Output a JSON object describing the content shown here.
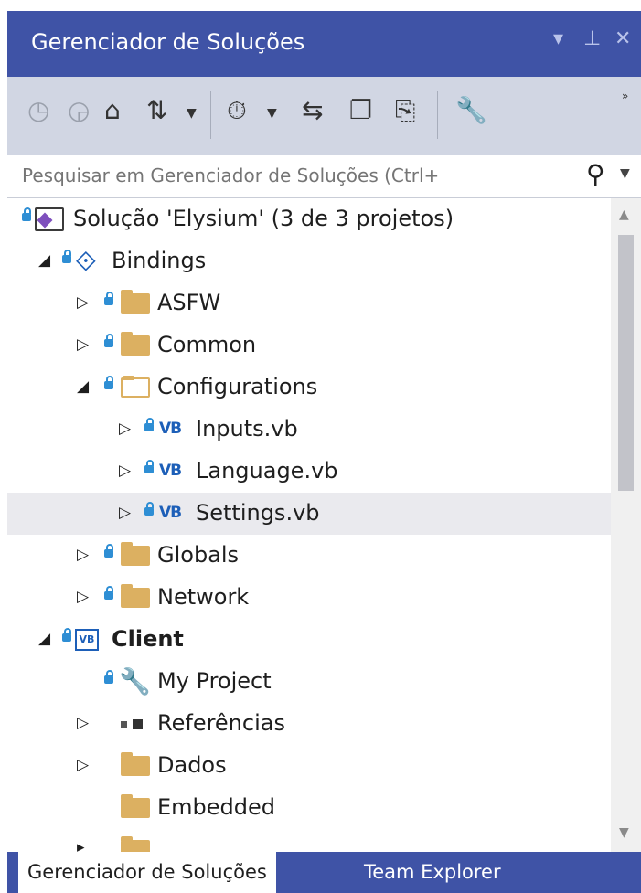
{
  "window": {
    "title": "Gerenciador de Soluções",
    "dropdown_icon": "chevron-down-icon",
    "pin_icon": "pin-icon",
    "close_icon": "close-icon"
  },
  "toolbar": {
    "buttons": [
      {
        "icon": "back-icon",
        "glyph": "◷"
      },
      {
        "icon": "forward-icon",
        "glyph": "◶"
      },
      {
        "icon": "home-icon",
        "glyph": "⌂"
      },
      {
        "icon": "switch-views-icon",
        "glyph": "⇅"
      },
      {
        "icon": "pending-changes-filter-icon",
        "glyph": "⏱"
      },
      {
        "icon": "sync-active-document-icon",
        "glyph": "⇆"
      },
      {
        "icon": "collapse-all-icon",
        "glyph": "❐"
      },
      {
        "icon": "show-all-files-icon",
        "glyph": "🗐"
      },
      {
        "icon": "properties-wrench-icon",
        "glyph": "🔧"
      }
    ]
  },
  "search": {
    "placeholder": "Pesquisar em Gerenciador de Soluções (Ctrl+"
  },
  "tree": [
    {
      "label": "Solução 'Elysium' (3 de 3 projetos)",
      "icon": "solution-icon"
    },
    {
      "label": "Bindings",
      "icon": "shared-project-icon",
      "expanded": true
    },
    {
      "label": "ASFW",
      "icon": "folder-icon",
      "expanded": false
    },
    {
      "label": "Common",
      "icon": "folder-icon",
      "expanded": false
    },
    {
      "label": "Configurations",
      "icon": "folder-open-icon",
      "expanded": true
    },
    {
      "label": "Inputs.vb",
      "icon": "vb-file-icon",
      "expanded": false
    },
    {
      "label": "Language.vb",
      "icon": "vb-file-icon",
      "expanded": false
    },
    {
      "label": "Settings.vb",
      "icon": "vb-file-icon",
      "expanded": false,
      "selected": true
    },
    {
      "label": "Globals",
      "icon": "folder-icon",
      "expanded": false
    },
    {
      "label": "Network",
      "icon": "folder-icon",
      "expanded": false
    },
    {
      "label": "Client",
      "icon": "vb-project-icon",
      "expanded": true,
      "bold": true
    },
    {
      "label": "My Project",
      "icon": "wrench-icon"
    },
    {
      "label": "Referências",
      "icon": "references-icon",
      "expanded": false
    },
    {
      "label": "Dados",
      "icon": "folder-icon",
      "expanded": false
    },
    {
      "label": "Embedded",
      "icon": "folder-icon"
    }
  ],
  "tabs": [
    {
      "label": "Gerenciador de Soluções",
      "active": true
    },
    {
      "label": "Team Explorer",
      "active": false
    }
  ],
  "colors": {
    "title_bar": "#3f53a6",
    "toolbar": "#d1d6e3",
    "selected_row": "#eaeaee",
    "lock_blue": "#2e8ed4",
    "folder": "#dcb061",
    "vb_blue": "#1d5fb8"
  }
}
